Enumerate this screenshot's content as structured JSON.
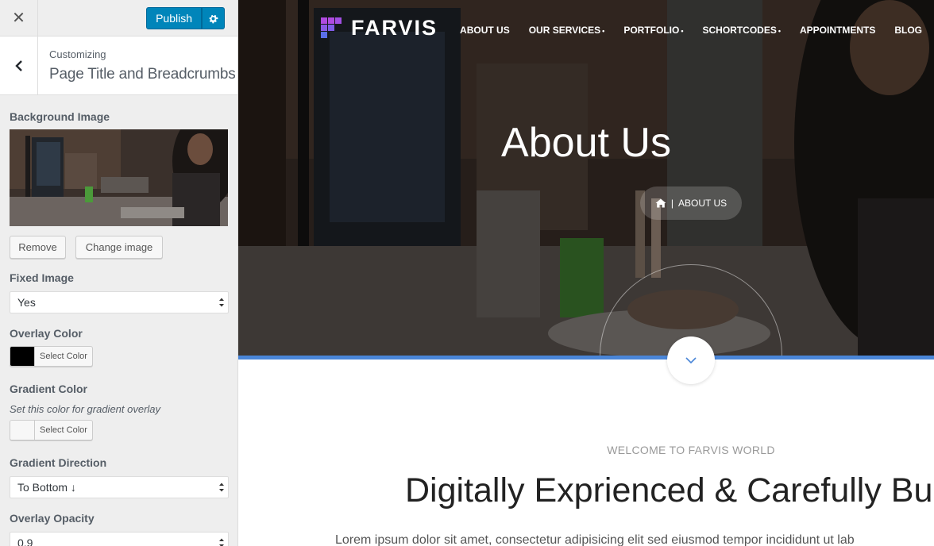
{
  "customizer": {
    "close_label": "✕",
    "publish_label": "Publish",
    "breadcrumb": "Customizing",
    "section_title": "Page Title and Breadcrumbs",
    "background_image": {
      "label": "Background Image",
      "remove_label": "Remove",
      "change_label": "Change image"
    },
    "fixed_image": {
      "label": "Fixed Image",
      "value": "Yes"
    },
    "overlay_color": {
      "label": "Overlay Color",
      "button_label": "Select Color",
      "swatch": "#000000"
    },
    "gradient_color": {
      "label": "Gradient Color",
      "description": "Set this color for gradient overlay",
      "button_label": "Select Color",
      "swatch": "#f7f7f7"
    },
    "gradient_direction": {
      "label": "Gradient Direction",
      "value": "To Bottom ↓"
    },
    "overlay_opacity": {
      "label": "Overlay Opacity",
      "value": "0.9"
    }
  },
  "preview": {
    "logo_text": "FARVIS",
    "nav": [
      {
        "label": "ABOUT US",
        "dropdown": false
      },
      {
        "label": "OUR SERVICES",
        "dropdown": true
      },
      {
        "label": "PORTFOLIO",
        "dropdown": true
      },
      {
        "label": "SCHORTCODES",
        "dropdown": true
      },
      {
        "label": "APPOINTMENTS",
        "dropdown": false
      },
      {
        "label": "BLOG",
        "dropdown": false
      }
    ],
    "page_title": "About Us",
    "breadcrumb_current": "ABOUT US",
    "breadcrumb_sep": "|",
    "welcome": "WELCOME TO FARVIS WORLD",
    "headline": "Digitally Exprienced & Carefully Bu",
    "body_text": "Lorem ipsum dolor sit amet, consectetur adipisicing elit sed eiusmod tempor incididunt ut lab"
  },
  "colors": {
    "publish": "#0085ba",
    "accent_bar": "#4a86d8",
    "logo_purple": "#b04be0",
    "logo_blue": "#5a6ee8"
  }
}
